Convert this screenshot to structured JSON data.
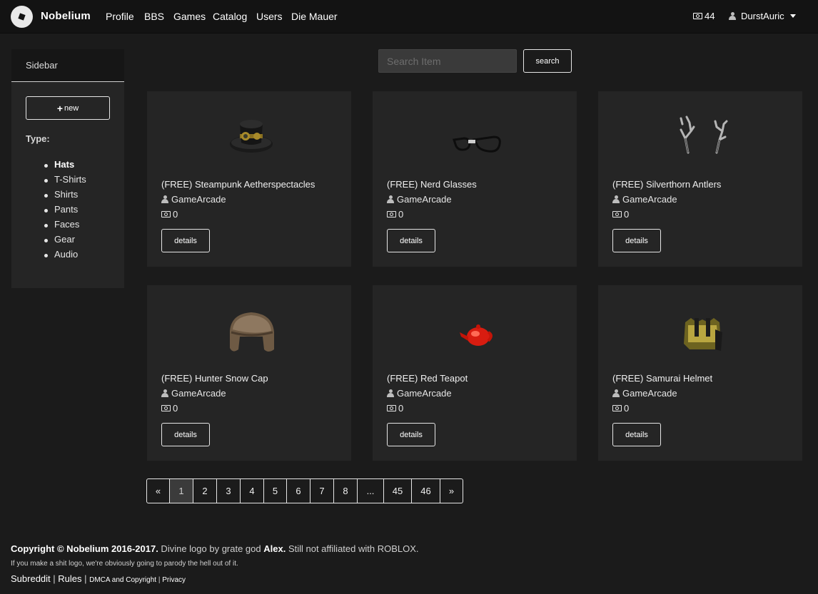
{
  "navbar": {
    "brand": "Nobelium",
    "links": [
      "Profile",
      "BBS",
      "Games",
      "Catalog",
      "Users",
      "Die Mauer"
    ],
    "currency": "44",
    "username": "DurstAuric"
  },
  "sidebar": {
    "title": "Sidebar",
    "new_label": "new",
    "type_label": "Type:",
    "types": [
      "Hats",
      "T-Shirts",
      "Shirts",
      "Pants",
      "Faces",
      "Gear",
      "Audio"
    ],
    "active_type": "Hats"
  },
  "search": {
    "placeholder": "Search Item",
    "button_label": "search"
  },
  "items": [
    {
      "title": "(FREE) Steampunk Aetherspectacles",
      "creator": "GameArcade",
      "price": "0",
      "details_label": "details",
      "icon": "steampunk-hat-icon"
    },
    {
      "title": "(FREE) Nerd Glasses",
      "creator": "GameArcade",
      "price": "0",
      "details_label": "details",
      "icon": "nerd-glasses-icon"
    },
    {
      "title": "(FREE) Silverthorn Antlers",
      "creator": "GameArcade",
      "price": "0",
      "details_label": "details",
      "icon": "antlers-icon"
    },
    {
      "title": "(FREE) Hunter Snow Cap",
      "creator": "GameArcade",
      "price": "0",
      "details_label": "details",
      "icon": "snow-cap-icon"
    },
    {
      "title": "(FREE) Red Teapot",
      "creator": "GameArcade",
      "price": "0",
      "details_label": "details",
      "icon": "teapot-icon"
    },
    {
      "title": "(FREE) Samurai Helmet",
      "creator": "GameArcade",
      "price": "0",
      "details_label": "details",
      "icon": "samurai-helmet-icon"
    }
  ],
  "pagination": {
    "pages": [
      "«",
      "1",
      "2",
      "3",
      "4",
      "5",
      "6",
      "7",
      "8",
      "...",
      "45",
      "46",
      "»"
    ],
    "current": "1"
  },
  "footer": {
    "copyright": "Copyright © Nobelium 2016-2017.",
    "logo_credit_prefix": " Divine logo by grate god ",
    "logo_author": "Alex.",
    "affiliation": " Still not affiliated with ROBLOX.",
    "small_note": "If you make a shit logo, we're obviously going to parody the hell out of it.",
    "links": {
      "subreddit": "Subreddit",
      "rules": "Rules",
      "dmca": "DMCA and Copyright",
      "privacy": "Privacy"
    },
    "separator": " | "
  }
}
